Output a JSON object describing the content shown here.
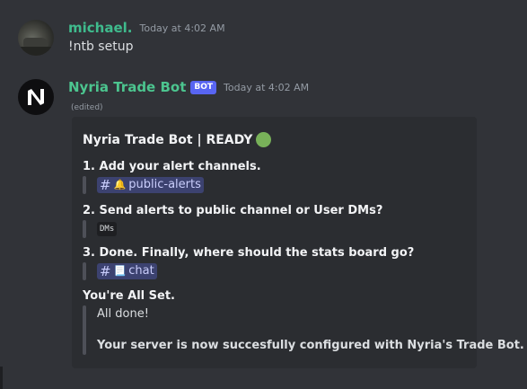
{
  "messages": [
    {
      "author": "michael.",
      "timestamp": "Today at 4:02 AM",
      "content": "!ntb setup",
      "avatar_icon": "car-photo-avatar"
    },
    {
      "author": "Nyria Trade Bot",
      "badge": "BOT",
      "timestamp": "Today at 4:02 AM",
      "edited": "(edited)",
      "avatar_icon": "nyria-logo-icon",
      "embed": {
        "title": "Nyria Trade Bot | READY",
        "status_emoji": "green-circle",
        "fields": [
          {
            "name": "1. Add your alert channels.",
            "channel": {
              "hash": "#",
              "emoji": "🔔",
              "label": "public-alerts"
            }
          },
          {
            "name": "2. Send alerts to public channel or User DMs?",
            "code": "DMs"
          },
          {
            "name": "3. Done. Finally, where should the stats board go?",
            "channel": {
              "hash": "#",
              "emoji": "📃",
              "label": "chat"
            }
          },
          {
            "name": "You're All Set.",
            "quote_line1": "All done!",
            "quote_line2": "Your server is now succesfully configured with Nyria's Trade Bot."
          }
        ]
      }
    }
  ],
  "colors": {
    "background": "#313338",
    "embed_bg": "#2b2d31",
    "user_name": "#3fbb8d",
    "bot_name": "#4cc58f",
    "bot_badge": "#5865f2",
    "mention_bg": "#3c4270",
    "ready_dot": "#78b159"
  }
}
